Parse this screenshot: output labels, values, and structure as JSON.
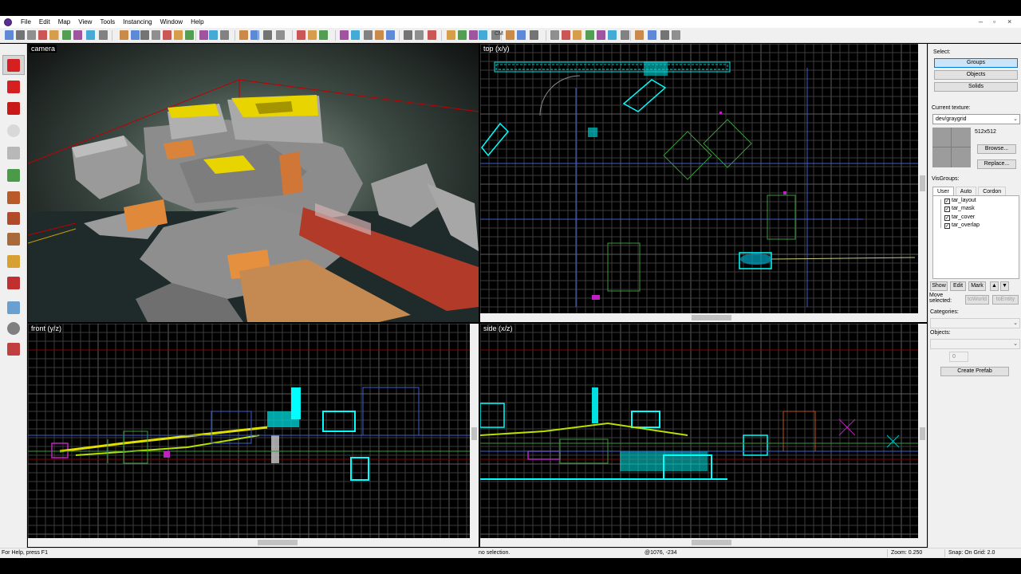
{
  "menu": {
    "items": [
      {
        "label": "File"
      },
      {
        "label": "Edit"
      },
      {
        "label": "Map"
      },
      {
        "label": "View"
      },
      {
        "label": "Tools"
      },
      {
        "label": "Instancing"
      },
      {
        "label": "Window"
      },
      {
        "label": "Help"
      }
    ],
    "window_controls": {
      "minimize": "–",
      "restore": "▫",
      "close": "×"
    }
  },
  "toolbar": {
    "cm_label": "CM"
  },
  "tools": [
    {
      "name": "selection-tool",
      "icon": "pointer-icon"
    },
    {
      "name": "magnify-tool",
      "icon": "magnify-icon"
    },
    {
      "name": "camera-tool",
      "icon": "camera-icon"
    },
    {
      "name": "entity-tool",
      "icon": "entity-icon"
    },
    {
      "name": "block-tool",
      "icon": "block-icon"
    },
    {
      "name": "texture-application-tool",
      "icon": "texture-apply-icon"
    },
    {
      "name": "apply-current-texture-tool",
      "icon": "apply-texture-icon"
    },
    {
      "name": "decal-tool",
      "icon": "decal-icon"
    },
    {
      "name": "overlay-tool",
      "icon": "overlay-icon"
    },
    {
      "name": "clipping-tool",
      "icon": "clip-icon"
    },
    {
      "name": "vertex-tool",
      "icon": "vertex-icon"
    },
    {
      "name": "path-tool",
      "icon": "path-icon"
    },
    {
      "name": "sprinkle-tool",
      "icon": "sprinkle-icon"
    },
    {
      "name": "cordon-tool",
      "icon": "cordon-icon"
    }
  ],
  "viewports": {
    "camera": {
      "label": "camera"
    },
    "top": {
      "label": "top (x/y)"
    },
    "front": {
      "label": "front (y/z)"
    },
    "side": {
      "label": "side (x/z)"
    }
  },
  "right_panel": {
    "select_label": "Select:",
    "select_buttons": [
      "Groups",
      "Objects",
      "Solids"
    ],
    "current_texture_label": "Current texture:",
    "current_texture": "dev/graygrid",
    "texture_size": "512x512",
    "browse_label": "Browse...",
    "replace_label": "Replace...",
    "visgroups_label": "VisGroups:",
    "tabs": [
      "User",
      "Auto",
      "Cordon"
    ],
    "visgroups": [
      {
        "name": "tar_layout",
        "checked": true
      },
      {
        "name": "tar_mask",
        "checked": true
      },
      {
        "name": "tar_cover",
        "checked": true
      },
      {
        "name": "tar_overlap",
        "checked": true
      }
    ],
    "list_buttons": {
      "show": "Show",
      "edit": "Edit",
      "mark": "Mark",
      "up": "▲",
      "down": "▼"
    },
    "move_selected_label": "Move selected:",
    "to_world": "toWorld",
    "to_entity": "toEntity",
    "categories_label": "Categories:",
    "objects_label": "Objects:",
    "objects_count": "0",
    "create_prefab": "Create Prefab"
  },
  "status": {
    "help": "For Help, press F1",
    "selection": "no selection.",
    "coords": "@1076, -234",
    "zoom": "Zoom: 0.250",
    "snap": "Snap: On Grid: 2.0"
  },
  "colors": {
    "grid_minor": "#3c3c3c",
    "grid_major": "#5e5e5e",
    "axis_red": "#8a0000",
    "brush_cyan": "#00ffff",
    "brush_green": "#3a9a3a",
    "brush_blue": "#3a5fd0",
    "brush_yellow": "#e0e000",
    "brush_magenta": "#c020c0"
  }
}
